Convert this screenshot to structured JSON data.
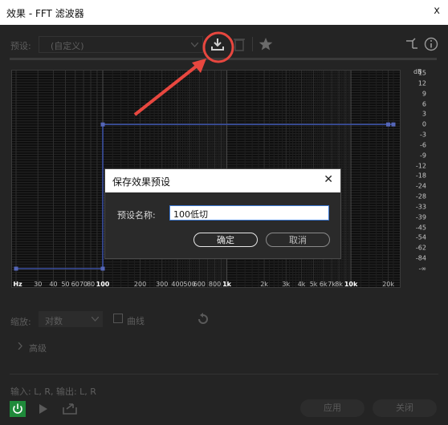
{
  "window": {
    "title": "效果 - FFT 滤波器",
    "close_glyph": "x"
  },
  "toolbar": {
    "preset_label": "预设:",
    "preset_value": "(自定义)",
    "icons": [
      "save-preset-icon",
      "delete-icon",
      "favorite-star-icon",
      "routing-icon",
      "info-icon"
    ]
  },
  "graph": {
    "db_unit": "dB",
    "db_ticks": [
      "15",
      "12",
      "9",
      "6",
      "3",
      "0",
      "-3",
      "-6",
      "-9",
      "-12",
      "-18",
      "-24",
      "-28",
      "-33",
      "-39",
      "-45",
      "-54",
      "-62",
      "-84",
      "-∞"
    ],
    "freq_ticks": [
      {
        "label": "Hz",
        "hz": 20,
        "bold": true
      },
      {
        "label": "30",
        "hz": 30
      },
      {
        "label": "40",
        "hz": 40
      },
      {
        "label": "50",
        "hz": 50
      },
      {
        "label": "60",
        "hz": 60
      },
      {
        "label": "70",
        "hz": 70
      },
      {
        "label": "80",
        "hz": 80
      },
      {
        "label": "100",
        "hz": 100,
        "bold": true
      },
      {
        "label": "200",
        "hz": 200
      },
      {
        "label": "300",
        "hz": 300
      },
      {
        "label": "400",
        "hz": 400
      },
      {
        "label": "500",
        "hz": 500
      },
      {
        "label": "600",
        "hz": 600
      },
      {
        "label": "800",
        "hz": 800
      },
      {
        "label": "1k",
        "hz": 1000,
        "bold": true
      },
      {
        "label": "2k",
        "hz": 2000
      },
      {
        "label": "3k",
        "hz": 3000
      },
      {
        "label": "4k",
        "hz": 4000
      },
      {
        "label": "5k",
        "hz": 5000
      },
      {
        "label": "6k",
        "hz": 6000
      },
      {
        "label": "7k",
        "hz": 7000
      },
      {
        "label": "8k",
        "hz": 8000
      },
      {
        "label": "10k",
        "hz": 10000,
        "bold": true
      },
      {
        "label": "20k",
        "hz": 20000
      }
    ],
    "curve_points": [
      {
        "hz": 20,
        "db": "-∞"
      },
      {
        "hz": 100,
        "db": "-∞"
      },
      {
        "hz": 100,
        "db": 0
      },
      {
        "hz": 22000,
        "db": 0
      }
    ]
  },
  "dialog": {
    "title": "保存效果预设",
    "close_glyph": "✕",
    "field_label": "预设名称:",
    "field_value": "100低切",
    "ok_label": "确定",
    "cancel_label": "取消"
  },
  "controls": {
    "scale_label": "缩放:",
    "scale_value": "对数",
    "curve_checkbox_label": "曲线",
    "advanced_label": "高级"
  },
  "footer": {
    "io_text": "输入: L, R, 输出: L, R",
    "apply_label": "应用",
    "close_label": "关闭"
  },
  "colors": {
    "annotation_red": "#e8473f",
    "curve_blue": "#3a4fa0",
    "power_green": "#1f8a3a"
  }
}
